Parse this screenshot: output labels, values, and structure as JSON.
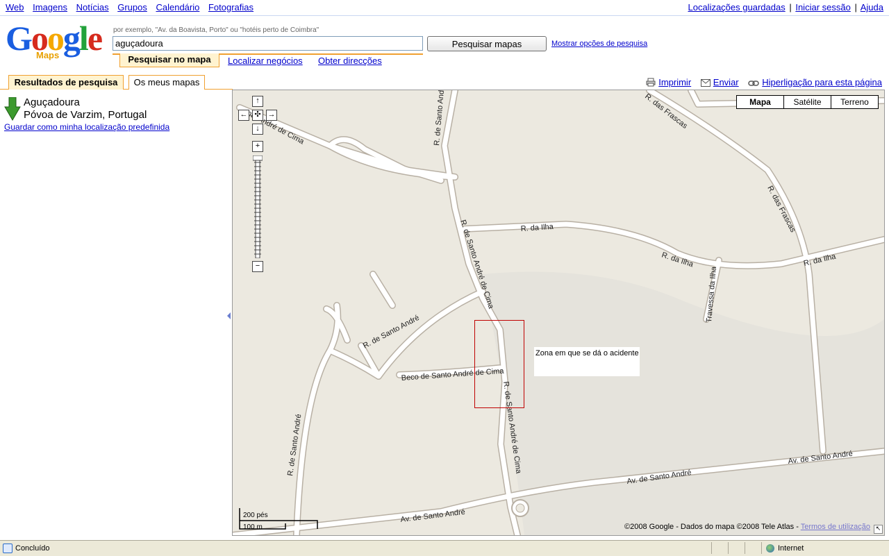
{
  "topnav": {
    "left": [
      "Web",
      "Imagens",
      "Notícias",
      "Grupos",
      "Calendário",
      "Fotografias"
    ],
    "saved_locations": "Localizações guardadas",
    "sign_in": "Iniciar sessão",
    "help": "Ajuda",
    "separator": "|"
  },
  "logo": {
    "word": "Google",
    "sub": "Maps",
    "colors": [
      "#1a5ee0",
      "#d62b1e",
      "#f5a800",
      "#1a5ee0",
      "#22a23a",
      "#d62b1e"
    ]
  },
  "search": {
    "hint": "por exemplo, \"Av. da Boavista, Porto\" ou \"hotéis perto de Coimbra\"",
    "value": "aguçadoura",
    "button": "Pesquisar mapas",
    "options_link": "Mostrar opções de pesquisa"
  },
  "modes": {
    "search_map": "Pesquisar no mapa",
    "find_business": "Localizar negócios",
    "directions": "Obter direcções"
  },
  "tabs": {
    "results": "Resultados de pesquisa",
    "my_maps": "Os meus mapas"
  },
  "toolbar": {
    "print": "Imprimir",
    "send": "Enviar",
    "link": "Hiperligação para esta página"
  },
  "result": {
    "name": "Aguçadoura",
    "region": "Póvoa de Varzim, Portugal",
    "save_default": "Guardar como minha localização predefinida",
    "marker_color": "#3c9a2e"
  },
  "map": {
    "types": [
      "Mapa",
      "Satélite",
      "Terreno"
    ],
    "selected_type": "Mapa",
    "zoom_in": "+",
    "zoom_out": "−",
    "street_labels": {
      "santo_andre_cima_1": "R. de Santo André de Cima",
      "santo_andre_cima_2": "R. de Santo André de Cima",
      "santo_andre_cima_3": "R. de Santo André de Cima",
      "santo_andre_cima_4": "R. de Santo André",
      "santo_andre_cima_nw": "nto André de Cima",
      "frascas_1": "R. das Frascas",
      "frascas_2": "R. das Frascas",
      "ilha_1": "R. da Ilha",
      "ilha_2": "R. da Ilha",
      "ilha_3": "R. da Ilha",
      "travessa_ilha": "Travessa da Ilha",
      "santo_andre_1": "R. de Santo André",
      "santo_andre_2": "R. de Santo André",
      "beco": "Beco de Santo André de Cima",
      "av_1": "Av. de Santo André",
      "av_2": "Av. de Santo André",
      "av_3": "Av. de Santo André"
    },
    "annotation": "Zona em que se dá o acidente",
    "scale": {
      "feet": "200 pés",
      "meters": "100 m"
    },
    "copyright": "©2008 Google - Dados do mapa ©2008 Tele Atlas - ",
    "terms": "Termos de utilização"
  },
  "status": {
    "text": "Concluído",
    "zone": "Internet"
  }
}
